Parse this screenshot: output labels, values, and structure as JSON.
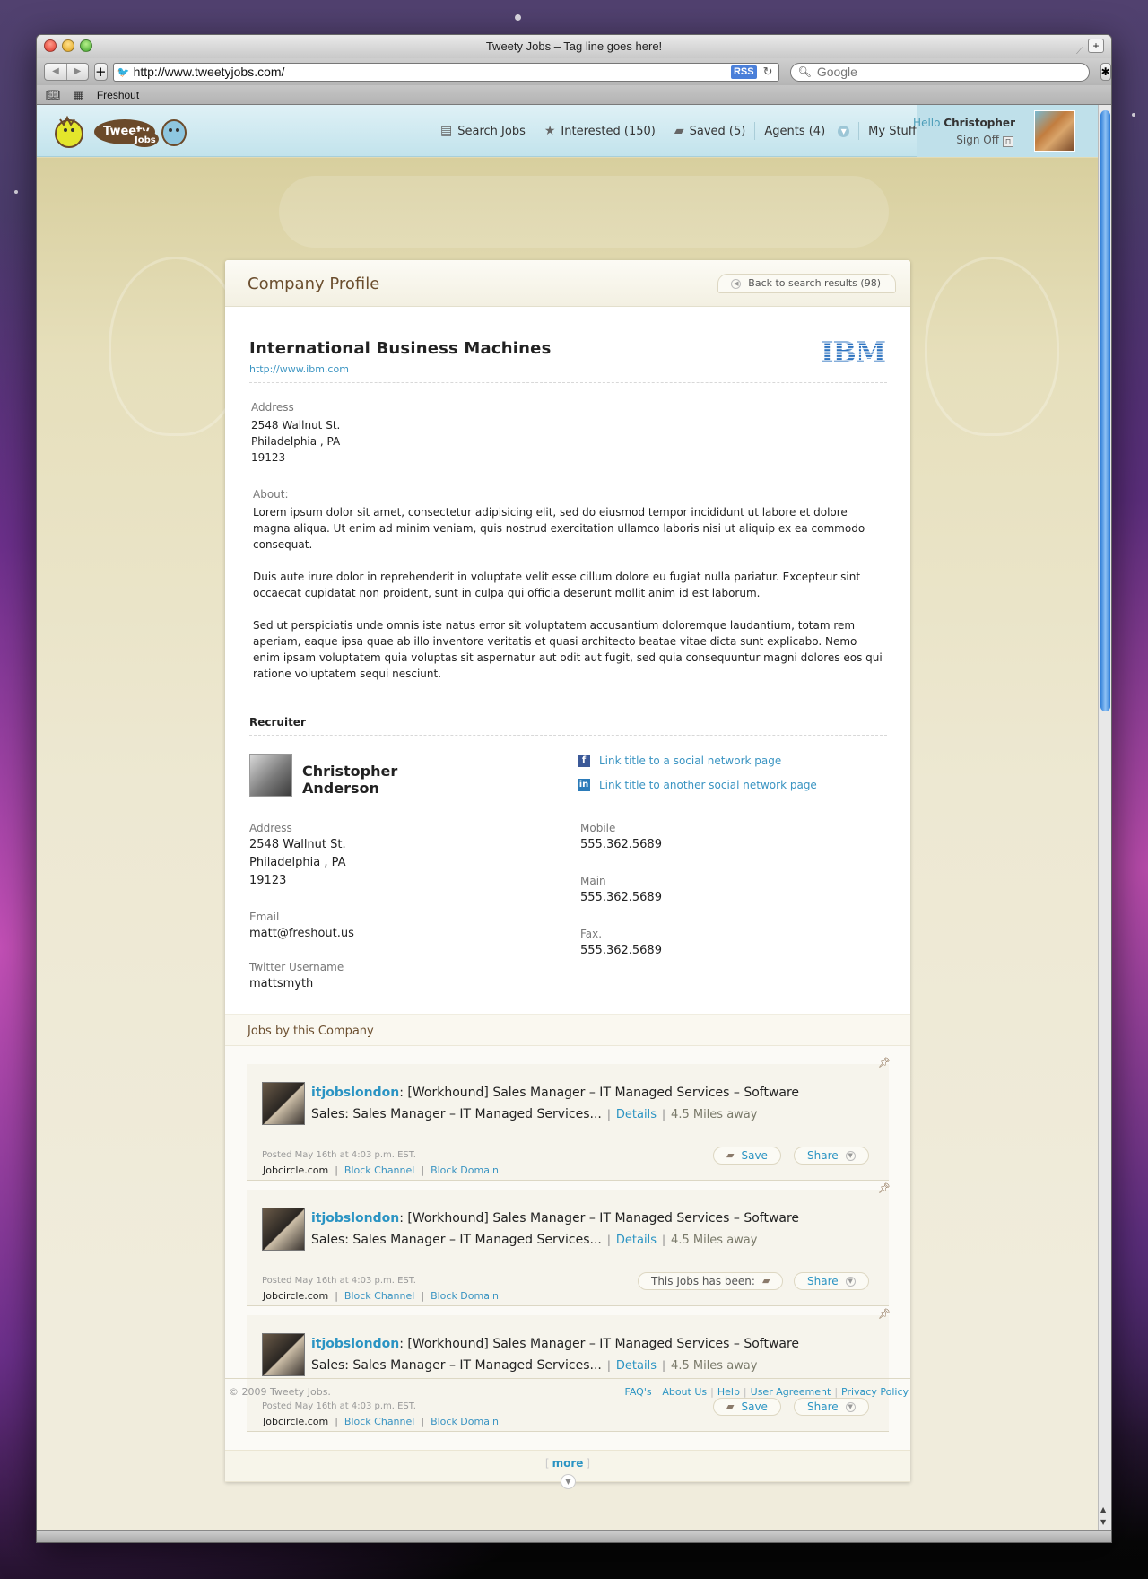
{
  "browser": {
    "title": "Tweety Jobs – Tag line goes here!",
    "url": "http://www.tweetyjobs.com/",
    "rss": "RSS",
    "search_placeholder": "Google",
    "bookmark": "Freshout"
  },
  "header": {
    "nav": [
      {
        "label": "Search Jobs",
        "icon": "newspaper-icon"
      },
      {
        "label": "Interested (150)",
        "icon": "star-icon"
      },
      {
        "label": "Saved (5)",
        "icon": "box-icon"
      },
      {
        "label": "Agents (4)",
        "icon": "chevron-down-icon"
      },
      {
        "label": "My Stuff",
        "icon": "chevron-down-icon"
      }
    ],
    "hello": "Hello",
    "user": "Christopher",
    "sign_off": "Sign Off"
  },
  "profile": {
    "heading": "Company Profile",
    "back": "Back to search results (98)",
    "company_name": "International Business Machines",
    "company_url": "http://www.ibm.com",
    "logo_text": "IBM",
    "address_label": "Address",
    "address": [
      "2548 Wallnut St.",
      "Philadelphia , PA",
      "19123"
    ],
    "about_label": "About:",
    "about": [
      "Lorem ipsum dolor sit amet, consectetur adipisicing elit, sed do eiusmod tempor incididunt ut labore et dolore magna aliqua. Ut enim ad minim veniam, quis nostrud exercitation ullamco laboris nisi ut aliquip ex ea commodo consequat.",
      "Duis aute irure dolor in reprehenderit in voluptate velit esse cillum dolore eu fugiat nulla pariatur. Excepteur sint occaecat cupidatat non proident, sunt in culpa qui officia deserunt mollit anim id est laborum.",
      "Sed ut perspiciatis unde omnis iste natus error sit voluptatem accusantium doloremque laudantium, totam rem aperiam, eaque ipsa quae ab illo inventore veritatis et quasi architecto beatae vitae dicta sunt explicabo. Nemo enim ipsam voluptatem quia voluptas sit aspernatur aut odit aut fugit, sed quia consequuntur magni dolores eos qui ratione voluptatem sequi nesciunt."
    ]
  },
  "recruiter": {
    "heading": "Recruiter",
    "first_name": "Christopher",
    "last_name": "Anderson",
    "social_1": "Link title to a social network page",
    "social_2": "Link title to another social network page",
    "address_label": "Address",
    "address": [
      "2548 Wallnut St.",
      "Philadelphia , PA",
      "19123"
    ],
    "email_label": "Email",
    "email": "matt@freshout.us",
    "twitter_label": "Twitter Username",
    "twitter": "mattsmyth",
    "mobile_label": "Mobile",
    "mobile": "555.362.5689",
    "main_label": "Main",
    "main": "555.362.5689",
    "fax_label": "Fax.",
    "fax": "555.362.5689"
  },
  "jobs": {
    "heading": "Jobs by this Company",
    "items": [
      {
        "handle": "itjobslondon",
        "text": ": [Workhound] Sales Manager – IT Managed Services – Software Sales: Sales Manager – IT Managed Services...",
        "details": "Details",
        "distance": "4.5 Miles away",
        "posted": "Posted May 16th at 4:03 p.m. EST.",
        "source": "Jobcircle.com",
        "block_channel": "Block Channel",
        "block_domain": "Block Domain",
        "save": "Save",
        "share": "Share",
        "status": ""
      },
      {
        "handle": "itjobslondon",
        "text": ": [Workhound] Sales Manager – IT Managed Services – Software Sales: Sales Manager – IT Managed Services...",
        "details": "Details",
        "distance": "4.5 Miles away",
        "posted": "Posted May 16th at 4:03 p.m. EST.",
        "source": "Jobcircle.com",
        "block_channel": "Block Channel",
        "block_domain": "Block Domain",
        "save": "",
        "share": "Share",
        "status": "This Jobs has been:"
      },
      {
        "handle": "itjobslondon",
        "text": ": [Workhound] Sales Manager – IT Managed Services – Software Sales: Sales Manager – IT Managed Services...",
        "details": "Details",
        "distance": "4.5 Miles away",
        "posted": "Posted May 16th at 4:03 p.m. EST.",
        "source": "Jobcircle.com",
        "block_channel": "Block Channel",
        "block_domain": "Block Domain",
        "save": "Save",
        "share": "Share",
        "status": ""
      }
    ],
    "more": "more"
  },
  "footer": {
    "copyright": "© 2009 Tweety Jobs.",
    "links": [
      "FAQ's",
      "About Us",
      "Help",
      "User Agreement",
      "Privacy Policy"
    ]
  }
}
